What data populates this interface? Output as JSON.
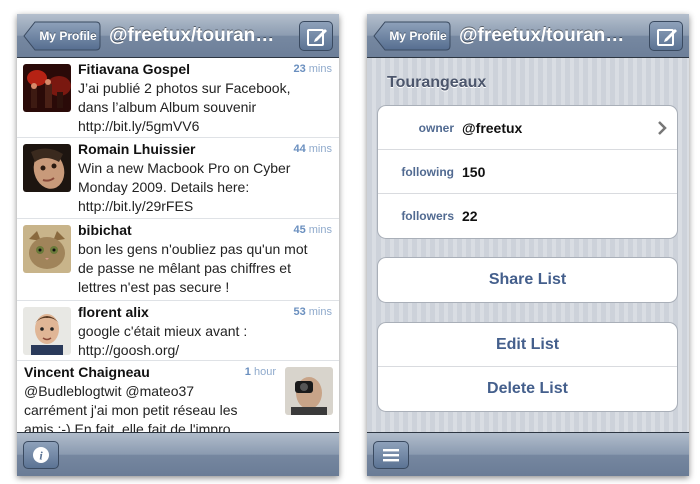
{
  "colors": {
    "accent": "#6a8fbf",
    "nav_bar": "#7d8ea6",
    "link_blue": "#445f8c"
  },
  "left": {
    "navbar": {
      "back_label": "My Profile",
      "title": "@freetux/touran…",
      "compose_icon": "compose-icon"
    },
    "tweets": [
      {
        "name": "Fitiavana Gospel",
        "time_num": "23",
        "time_unit": "mins",
        "lines": [
          "J’ai publié 2 photos sur Facebook,",
          "dans l’album Album souvenir",
          "http://bit.ly/5gmVV6"
        ]
      },
      {
        "name": "Romain Lhuissier",
        "time_num": "44",
        "time_unit": "mins",
        "lines": [
          "Win a new Macbook Pro on Cyber",
          "Monday 2009. Details here:",
          "http://bit.ly/29rFES"
        ]
      },
      {
        "name": "bibichat",
        "time_num": "45",
        "time_unit": "mins",
        "lines": [
          "bon les gens n'oubliez pas qu'un mot",
          "de passe ne mêlant pas chiffres et",
          "lettres n'est pas secure !"
        ]
      },
      {
        "name": "florent alix",
        "time_num": "53",
        "time_unit": "mins",
        "lines": [
          "google c'était mieux avant :",
          "http://goosh.org/"
        ]
      },
      {
        "name": "Vincent Chaigneau",
        "time_num": "1",
        "time_unit": "hour",
        "lines": [
          "@Budleblogtwit @mateo37",
          "carrément j'ai mon petit réseau les",
          "amis ;-) En fait, elle fait de l'impro"
        ]
      }
    ],
    "toolbar": {
      "info_icon": "info-icon"
    }
  },
  "right": {
    "navbar": {
      "back_label": "My Profile",
      "title": "@freetux/touran…",
      "compose_icon": "compose-icon"
    },
    "list_name": "Tourangeaux",
    "details": [
      {
        "key": "owner",
        "value": "@freetux"
      },
      {
        "key": "following",
        "value": "150"
      },
      {
        "key": "followers",
        "value": "22"
      }
    ],
    "share_label": "Share List",
    "edit_label": "Edit List",
    "delete_label": "Delete List",
    "toolbar": {
      "menu_icon": "menu-icon"
    }
  }
}
